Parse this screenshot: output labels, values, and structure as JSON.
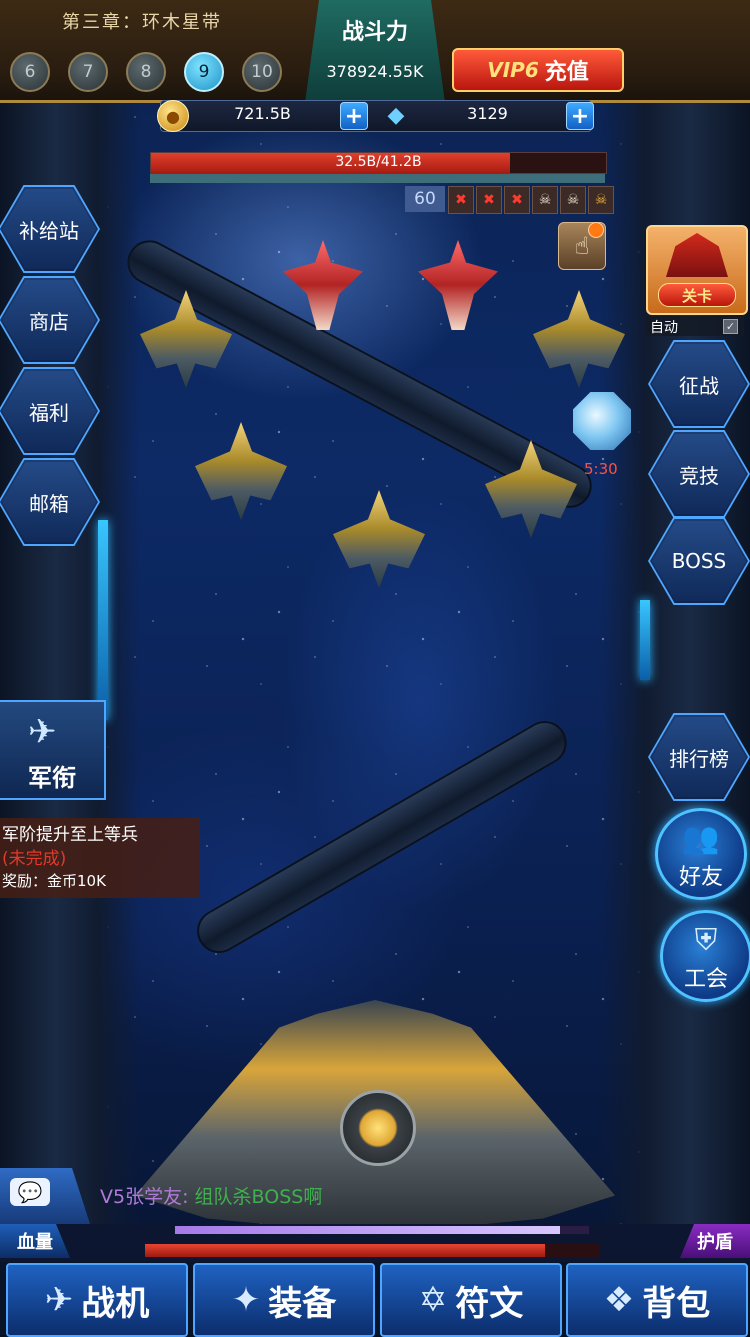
{
  "header": {
    "chapter": "第三章：环木星带",
    "levels": [
      {
        "label": "6",
        "active": false
      },
      {
        "label": "7",
        "active": false
      },
      {
        "label": "8",
        "active": false
      },
      {
        "label": "9",
        "active": true
      },
      {
        "label": "10",
        "active": false
      }
    ],
    "power_title": "战斗力",
    "power_value": "378924.55K",
    "vip_tag": "VIP6",
    "vip_label": "充值"
  },
  "resources": {
    "gold": "721.5B",
    "gems": "3129",
    "plus": "+"
  },
  "boss": {
    "hp_text": "32.5B/41.2B",
    "hp_fraction": 0.79,
    "wave_count": "60",
    "wave_icons": [
      {
        "type": "x",
        "glyph": "✖"
      },
      {
        "type": "x",
        "glyph": "✖"
      },
      {
        "type": "x",
        "glyph": "✖"
      },
      {
        "type": "s",
        "glyph": "☠"
      },
      {
        "type": "s",
        "glyph": "☠"
      },
      {
        "type": "b",
        "glyph": "☠"
      }
    ]
  },
  "left_menu": {
    "items": [
      {
        "label": "补给站"
      },
      {
        "label": "商店"
      },
      {
        "label": "福利"
      },
      {
        "label": "邮箱"
      }
    ],
    "army_label": "军衔",
    "army_emblem": "✈"
  },
  "task": {
    "title": "军阶提升至上等兵",
    "status": "(未完成)",
    "reward": "奖励：金币10K"
  },
  "right_menu": {
    "stage_label": "关卡",
    "auto_label": "自动",
    "auto_checked": true,
    "timer": "5:30",
    "hex_items": [
      {
        "label": "征战"
      },
      {
        "label": "竞技"
      },
      {
        "label": "BOSS"
      },
      {
        "label": "排行榜"
      }
    ],
    "friends_label": "好友",
    "friends_icon": "👥",
    "guild_label": "工会",
    "guild_icon": "⛨"
  },
  "chat": {
    "sender": "V5张学友:",
    "text": "组队杀BOSS啊",
    "icon": "💬"
  },
  "player": {
    "hp_label": "血量",
    "shield_label": "护盾",
    "hp_fraction": 0.88,
    "shield_fraction": 0.93
  },
  "bottom_nav": [
    {
      "label": "战机",
      "icon": "✈"
    },
    {
      "label": "装备",
      "icon": "✦"
    },
    {
      "label": "符文",
      "icon": "✡"
    },
    {
      "label": "背包",
      "icon": "❖"
    }
  ]
}
